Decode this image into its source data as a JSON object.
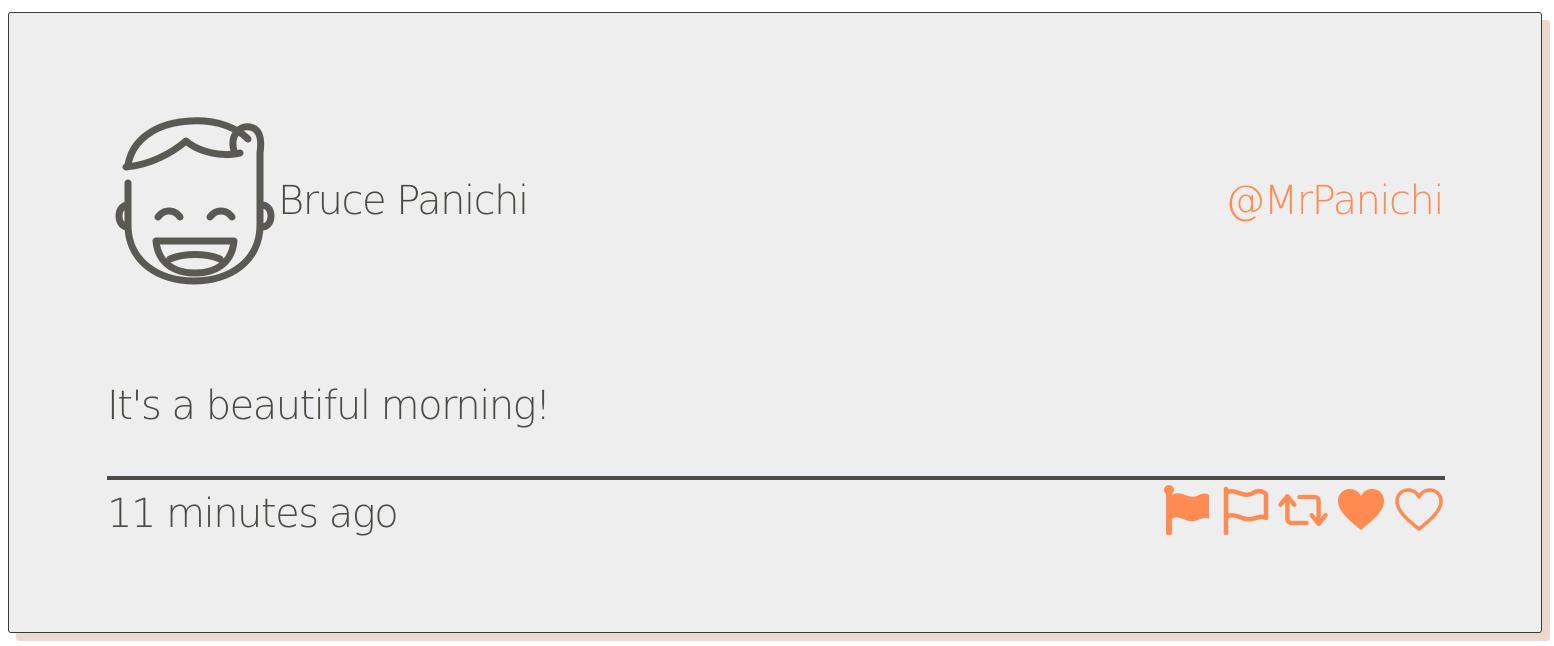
{
  "tweet": {
    "user_name": "Bruce Panichi",
    "handle": "@MrPanichi",
    "message": "It's a beautiful morning!",
    "timestamp": "11 minutes ago",
    "avatar_icon": "smiling-face-avatar-icon"
  },
  "actions": [
    {
      "icon": "flag-filled-icon"
    },
    {
      "icon": "flag-outline-icon"
    },
    {
      "icon": "retweet-icon"
    },
    {
      "icon": "heart-filled-icon"
    },
    {
      "icon": "heart-outline-icon"
    }
  ],
  "colors": {
    "accent": "#ff8a52",
    "text": "#4b4a45",
    "card_background": "#eeeeee",
    "divider": "#4e4c45",
    "shadow": "#ecd8cf"
  }
}
